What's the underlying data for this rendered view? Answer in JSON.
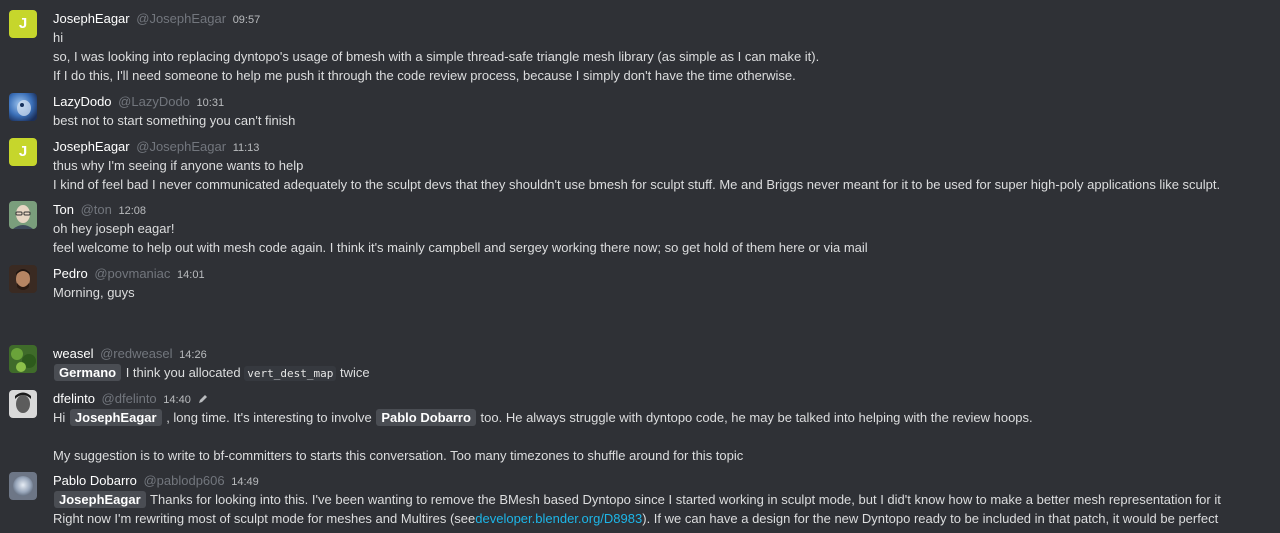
{
  "colors": {
    "background": "#2f3136",
    "text": "#dcddde",
    "username": "#ffffff",
    "handle": "#72767d",
    "mention_bg": "#4a4d53",
    "link": "#1db6e8",
    "joseph_avatar": "#c6d62c"
  },
  "messages": [
    {
      "author": "JosephEagar",
      "handle": "@JosephEagar",
      "time": "09:57",
      "avatar_letter": "J",
      "lines": [
        "hi",
        "so, I was looking into replacing dyntopo's usage of bmesh with a simple thread-safe triangle mesh library (as simple as I can make it).",
        "If I do this, I'll need someone to help me push it through the code review process, because I simply don't have the time otherwise."
      ]
    },
    {
      "author": "LazyDodo",
      "handle": "@LazyDodo",
      "time": "10:31",
      "lines": [
        "best not to start something you can't finish"
      ]
    },
    {
      "author": "JosephEagar",
      "handle": "@JosephEagar",
      "time": "11:13",
      "avatar_letter": "J",
      "lines": [
        "thus why I'm seeing if anyone wants to help",
        "I kind of feel bad I never communicated adequately to the sculpt devs that they shouldn't use bmesh for sculpt stuff. Me and Briggs never meant for it to be used for super high-poly applications like sculpt."
      ]
    },
    {
      "author": "Ton",
      "handle": "@ton",
      "time": "12:08",
      "lines": [
        "oh hey joseph eagar!",
        "feel welcome to help out with mesh code again. I think it's mainly campbell and sergey working there now; so get hold of them here or via mail"
      ]
    },
    {
      "author": "Pedro",
      "handle": "@povmaniac",
      "time": "14:01",
      "lines": [
        "Morning, guys"
      ]
    },
    {
      "author": "weasel",
      "handle": "@redweasel",
      "time": "14:26",
      "mention": "Germano",
      "text_a": "I think you allocated",
      "code": "vert_dest_map",
      "text_b": "twice"
    },
    {
      "author": "dfelinto",
      "handle": "@dfelinto",
      "time": "14:40",
      "hi": "Hi",
      "mention_1": "JosephEagar",
      "text_1": ", long time. It's interesting to involve",
      "mention_2": "Pablo Dobarro",
      "text_2": "too. He always struggle with dyntopo code, he may be talked into helping with the review hoops.",
      "line_2": "My suggestion is to write to bf-committers to starts this conversation. Too many timezones to shuffle around for this topic"
    },
    {
      "author": "Pablo Dobarro",
      "handle": "@pablodp606",
      "time": "14:49",
      "mention": "JosephEagar",
      "text_1": "Thanks for looking into this. I've been wanting to remove the BMesh based Dyntopo since I started working in sculpt mode, but I did't know how to make a better mesh representation for it",
      "text_2a": "Right now I'm rewriting most of sculpt mode for meshes and Multires (see",
      "link": "developer.blender.org/D8983",
      "text_2b": "). If we can have a design for the new Dyntopo ready to be included in that patch, it would be perfect"
    }
  ]
}
